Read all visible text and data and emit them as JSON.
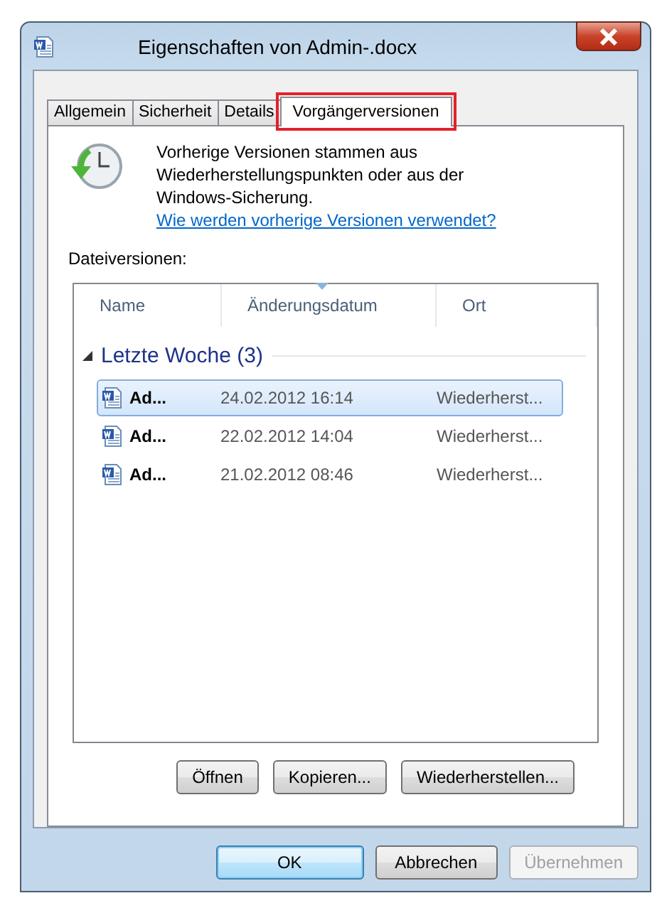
{
  "window": {
    "title": "Eigenschaften von Admin-.docx"
  },
  "tabs": [
    {
      "label": "Allgemein",
      "selected": false,
      "highlighted": false
    },
    {
      "label": "Sicherheit",
      "selected": false,
      "highlighted": false
    },
    {
      "label": "Details",
      "selected": false,
      "highlighted": false
    },
    {
      "label": "Vorgängerversionen",
      "selected": true,
      "highlighted": true
    }
  ],
  "intro": {
    "text": "Vorherige Versionen stammen aus Wiederherstellungspunkten oder aus der Windows-Sicherung.",
    "link": "Wie werden vorherige Versionen verwendet?"
  },
  "list_label": "Dateiversionen:",
  "table": {
    "columns": [
      "Name",
      "Änderungsdatum",
      "Ort"
    ],
    "group": {
      "label": "Letzte Woche (3)",
      "expanded": true
    },
    "rows": [
      {
        "name": "Ad...",
        "date": "24.02.2012 16:14",
        "location": "Wiederherst...",
        "selected": true
      },
      {
        "name": "Ad...",
        "date": "22.02.2012 14:04",
        "location": "Wiederherst...",
        "selected": false
      },
      {
        "name": "Ad...",
        "date": "21.02.2012 08:46",
        "location": "Wiederherst...",
        "selected": false
      }
    ]
  },
  "list_buttons": [
    {
      "label": "Öffnen",
      "disabled": false
    },
    {
      "label": "Kopieren...",
      "disabled": false
    },
    {
      "label": "Wiederherstellen...",
      "disabled": false
    }
  ],
  "dialog_buttons": [
    {
      "label": "OK",
      "disabled": false,
      "default": true
    },
    {
      "label": "Abbrechen",
      "disabled": false,
      "default": false
    },
    {
      "label": "Übernehmen",
      "disabled": true,
      "default": false
    }
  ]
}
